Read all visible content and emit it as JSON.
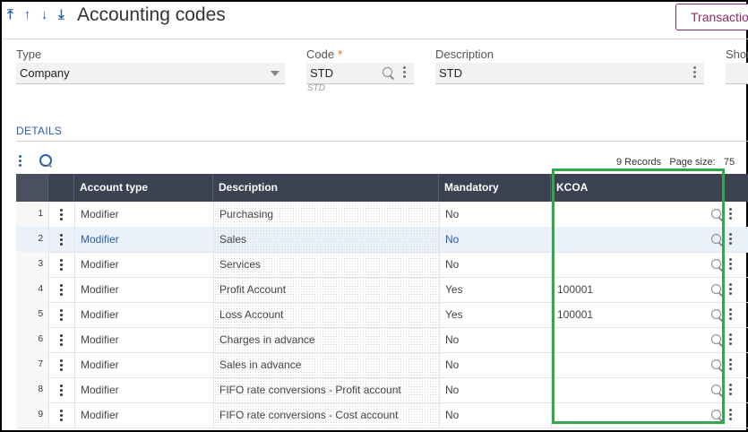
{
  "nav": {
    "first": "⤒",
    "up": "↑",
    "down": "↓",
    "last": "⤓"
  },
  "header": {
    "title": "Accounting codes",
    "transactions_button": "Transactio"
  },
  "fields": {
    "type": {
      "label": "Type",
      "value": "Company"
    },
    "code": {
      "label": "Code",
      "required_mark": "*",
      "value": "STD",
      "subtext": "STD"
    },
    "description": {
      "label": "Description",
      "value": "STD"
    },
    "short": {
      "label": "Shor"
    }
  },
  "details": {
    "section_title": "DETAILS",
    "records_text": "9 Records",
    "page_size_label": "Page size:",
    "page_size_value": "75"
  },
  "table": {
    "columns": [
      "Account type",
      "Description",
      "Mandatory",
      "KCOA"
    ],
    "rows": [
      {
        "num": "1",
        "account_type": "Modifier",
        "description": "Purchasing",
        "mandatory": "No",
        "kcoa": ""
      },
      {
        "num": "2",
        "account_type": "Modifier",
        "description": "Sales",
        "mandatory": "No",
        "kcoa": ""
      },
      {
        "num": "3",
        "account_type": "Modifier",
        "description": "Services",
        "mandatory": "No",
        "kcoa": ""
      },
      {
        "num": "4",
        "account_type": "Modifier",
        "description": "Profit Account",
        "mandatory": "Yes",
        "kcoa": "100001"
      },
      {
        "num": "5",
        "account_type": "Modifier",
        "description": "Loss Account",
        "mandatory": "Yes",
        "kcoa": "100001"
      },
      {
        "num": "6",
        "account_type": "Modifier",
        "description": "Charges in advance",
        "mandatory": "No",
        "kcoa": ""
      },
      {
        "num": "7",
        "account_type": "Modifier",
        "description": "Sales in advance",
        "mandatory": "No",
        "kcoa": ""
      },
      {
        "num": "8",
        "account_type": "Modifier",
        "description": "FIFO rate conversions - Profit account",
        "mandatory": "No",
        "kcoa": ""
      },
      {
        "num": "9",
        "account_type": "Modifier",
        "description": "FIFO rate conversions - Cost account",
        "mandatory": "No",
        "kcoa": ""
      }
    ]
  },
  "colors": {
    "accent": "#2a5ea8",
    "header_bg": "#3b4252",
    "highlight": "#2eaa4d",
    "button": "#8a2b66"
  }
}
